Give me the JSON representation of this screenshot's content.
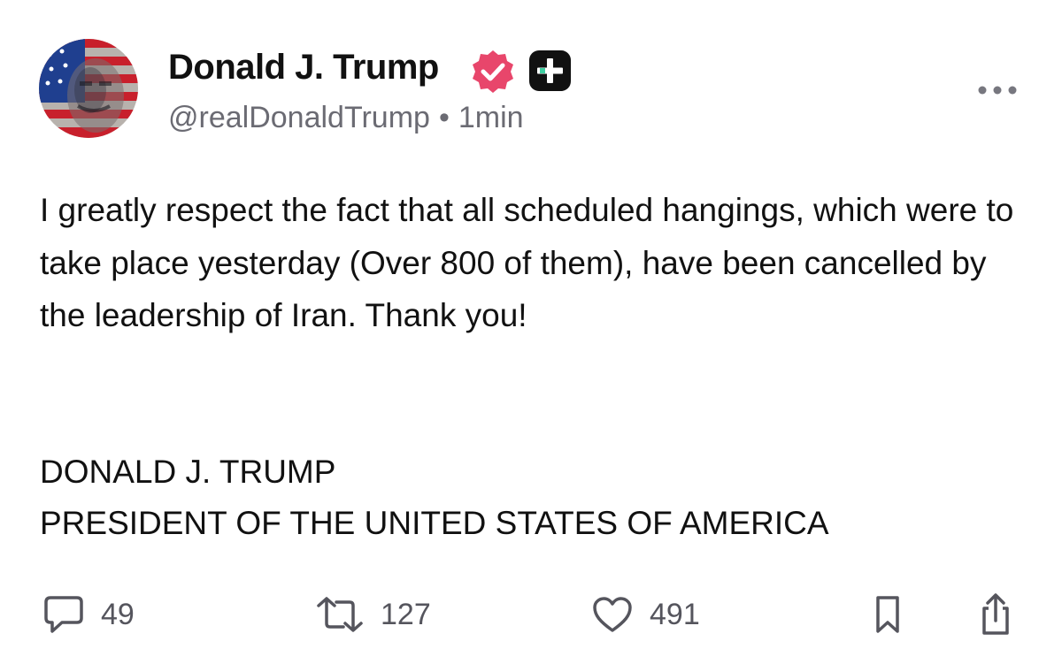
{
  "author": {
    "display_name": "Donald J. Trump",
    "handle": "@realDonaldTrump",
    "separator": "•",
    "timestamp": "1min",
    "verified_color": "#e8466b",
    "badge_color": "#111111",
    "badge_accent": "#3ecfa1"
  },
  "post": {
    "paragraph": "I greatly respect the fact that all scheduled hangings, which were to take place yesterday (Over 800 of them), have been cancelled by the leadership of Iran. Thank you!",
    "signature_line1": "DONALD J. TRUMP",
    "signature_line2": "PRESIDENT OF THE UNITED STATES OF AMERICA"
  },
  "actions": {
    "replies": "49",
    "restores": "127",
    "likes": "491",
    "icons": [
      "reply-icon",
      "restore-icon",
      "like-icon",
      "bookmark-icon",
      "share-icon"
    ]
  }
}
